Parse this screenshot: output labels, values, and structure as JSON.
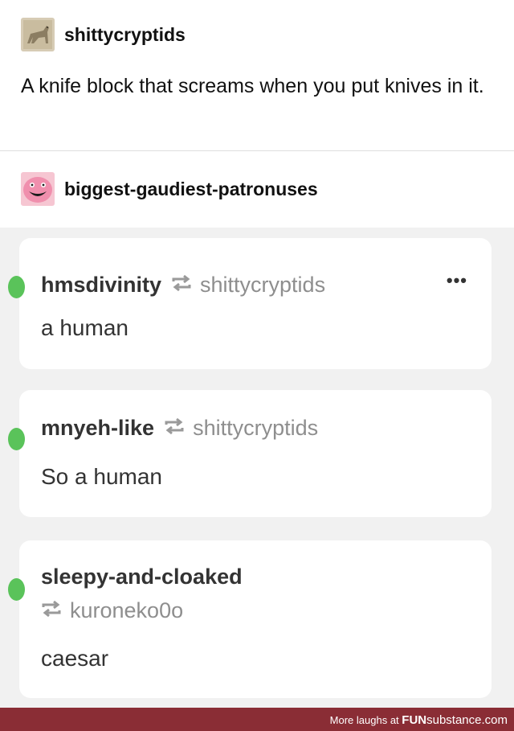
{
  "op": {
    "blog_name": "shittycryptids",
    "avatar_icon": "cryptid-avatar",
    "text": "A knife block that screams when you put knives in it."
  },
  "reblogger": {
    "blog_name": "biggest-gaudiest-patronuses",
    "avatar_icon": "pink-blob-avatar"
  },
  "notes": [
    {
      "user": "hmsdivinity",
      "reblogged_from": "shittycryptids",
      "text": "a human",
      "more_label": "•••"
    },
    {
      "user": "mnyeh-like",
      "reblogged_from": "shittycryptids",
      "text": "So a human"
    },
    {
      "user": "sleepy-and-cloaked",
      "reblogged_from": "kuroneko0o",
      "text": "caesar"
    }
  ],
  "footer": {
    "prefix": "More laughs at ",
    "brand_bold": "FUN",
    "brand_rest": "substance.com"
  },
  "colors": {
    "accent_dot": "#5ac35a",
    "footer_bg": "#8a2d35",
    "notes_bg": "#f1f1f1"
  }
}
